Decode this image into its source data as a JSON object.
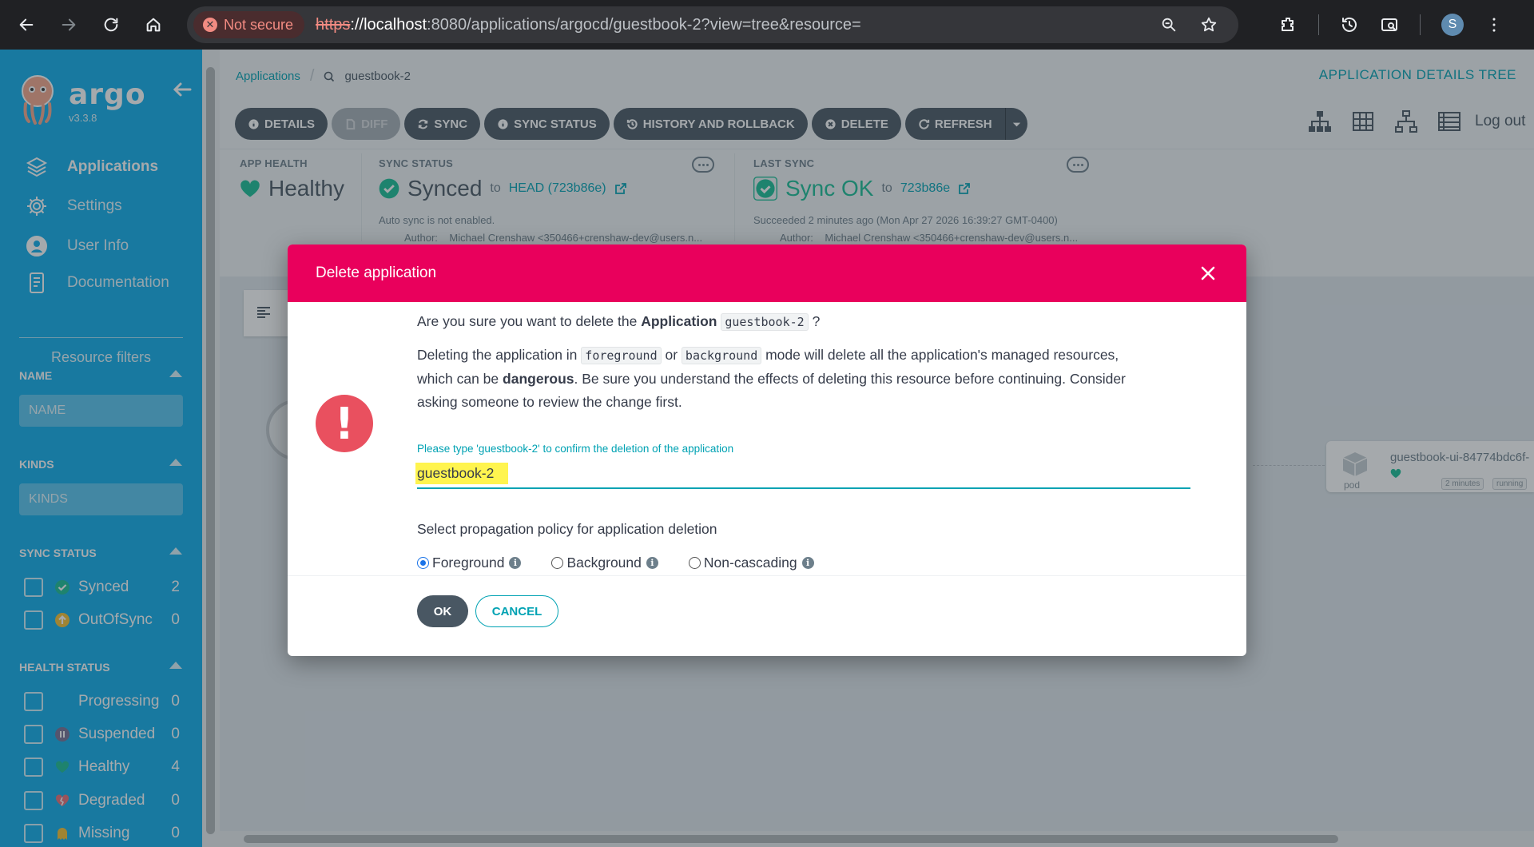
{
  "browser": {
    "security_label": "Not secure",
    "url_scheme": "https",
    "url_host": "://localhost",
    "url_rest": ":8080/applications/argocd/guestbook-2?view=tree&resource=",
    "profile_initial": "S"
  },
  "sidebar": {
    "brand": "argo",
    "version": "v3.3.8",
    "nav": [
      {
        "label": "Applications",
        "icon": "layers-icon",
        "active": true
      },
      {
        "label": "Settings",
        "icon": "gear-icon"
      },
      {
        "label": "User Info",
        "icon": "user-icon"
      },
      {
        "label": "Documentation",
        "icon": "book-icon"
      }
    ],
    "filters_title": "Resource filters",
    "name_label": "NAME",
    "name_placeholder": "NAME",
    "kinds_label": "KINDS",
    "kinds_placeholder": "KINDS",
    "sync_status_label": "SYNC STATUS",
    "sync_status": [
      {
        "label": "Synced",
        "count": "2",
        "color": "#18be94"
      },
      {
        "label": "OutOfSync",
        "count": "0",
        "color": "#f4c030"
      }
    ],
    "health_status_label": "HEALTH STATUS",
    "health_status": [
      {
        "label": "Progressing",
        "count": "0",
        "color": "#0dadea"
      },
      {
        "label": "Suspended",
        "count": "0",
        "color": "#766f94"
      },
      {
        "label": "Healthy",
        "count": "4",
        "color": "#18be94"
      },
      {
        "label": "Degraded",
        "count": "0",
        "color": "#e96d76"
      },
      {
        "label": "Missing",
        "count": "0",
        "color": "#f4c030"
      }
    ]
  },
  "header": {
    "crumb_root": "Applications",
    "crumb_app": "guestbook-2",
    "view_title": "APPLICATION DETAILS TREE",
    "toolbar": {
      "details": "DETAILS",
      "diff": "DIFF",
      "sync": "SYNC",
      "sync_status": "SYNC STATUS",
      "history": "HISTORY AND ROLLBACK",
      "delete": "DELETE",
      "refresh": "REFRESH"
    },
    "logout": "Log out"
  },
  "status": {
    "app_health_label": "APP HEALTH",
    "app_health_value": "Healthy",
    "sync_status_label": "SYNC STATUS",
    "sync_status_value": "Synced",
    "sync_to": "to",
    "sync_rev": "HEAD (723b86e)",
    "auto_sync": "Auto sync is not enabled.",
    "author_label": "Author:",
    "author_value": "Michael Crenshaw <350466+crenshaw-dev@users.n...",
    "last_sync_label": "LAST SYNC",
    "last_sync_value": "Sync OK",
    "last_sync_to": "to",
    "last_sync_rev": "723b86e",
    "last_sync_time": "Succeeded 2 minutes ago (Mon Apr 27 2026 16:39:27 GMT-0400)",
    "last_author_label": "Author:",
    "last_author_value": "Michael Crenshaw <350466+crenshaw-dev@users.n..."
  },
  "tree": {
    "pod_name": "guestbook-ui-84774bdc6f-",
    "pod_kind": "pod",
    "pod_age": "2 minutes",
    "pod_state": "running"
  },
  "modal": {
    "title": "Delete application",
    "q_prefix": "Are you sure you want to delete the",
    "q_kind": "Application",
    "q_name": "guestbook-2",
    "q_suffix": "?",
    "desc_1": "Deleting the application in",
    "desc_code1": "foreground",
    "desc_or": "or",
    "desc_code2": "background",
    "desc_2": "mode will delete all the application's managed resources,",
    "desc_3": "which can be",
    "desc_danger": "dangerous",
    "desc_4": ". Be sure you understand the effects of deleting this resource before continuing. Consider",
    "desc_5": "asking someone to review the change first.",
    "confirm_label": "Please type 'guestbook-2' to confirm the deletion of the application",
    "confirm_value": "guestbook-2",
    "policy_label": "Select propagation policy for application deletion",
    "policies": [
      "Foreground",
      "Background",
      "Non-cascading"
    ],
    "selected_policy": "Foreground",
    "ok": "OK",
    "cancel": "CANCEL"
  }
}
